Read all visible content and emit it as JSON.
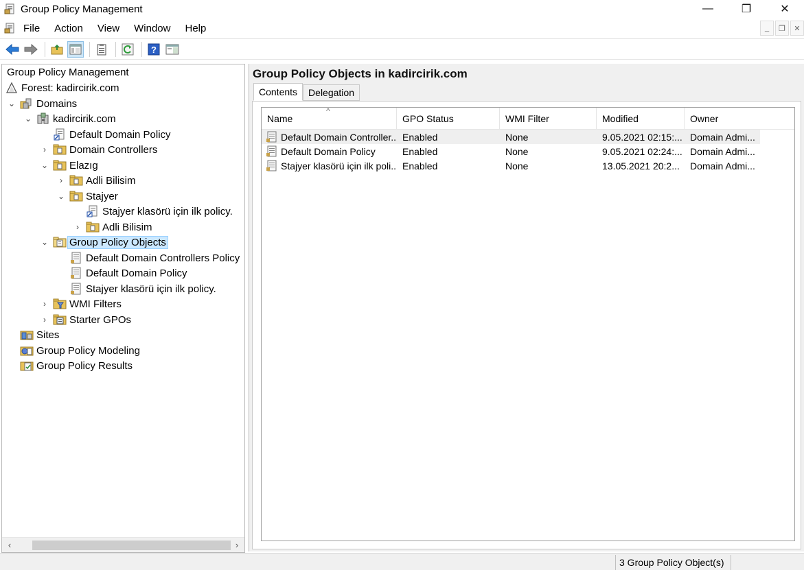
{
  "window": {
    "title": "Group Policy Management",
    "minimize": "—",
    "maximize": "❐",
    "close": "✕"
  },
  "menu": {
    "items": [
      "File",
      "Action",
      "View",
      "Window",
      "Help"
    ]
  },
  "tree": {
    "root": "Group Policy Management",
    "rows": [
      {
        "label": "Forest: kadircirik.com",
        "icon": "forest-icon"
      },
      {
        "label": "Domains",
        "icon": "domains-icon"
      },
      {
        "label": "kadircirik.com",
        "icon": "domain-icon"
      },
      {
        "label": "Default Domain Policy",
        "icon": "gpo-link-icon"
      },
      {
        "label": "Domain Controllers",
        "icon": "ou-icon"
      },
      {
        "label": "Elazıg",
        "icon": "ou-icon"
      },
      {
        "label": "Adli Bilisim",
        "icon": "ou-icon"
      },
      {
        "label": "Stajyer",
        "icon": "ou-icon"
      },
      {
        "label": "Stajyer klasörü için ilk policy.",
        "icon": "gpo-link-icon"
      },
      {
        "label": "Adli Bilisim",
        "icon": "ou-icon"
      },
      {
        "label": "Group Policy Objects",
        "icon": "gpo-folder-icon"
      },
      {
        "label": "Default Domain Controllers Policy",
        "icon": "gpo-icon"
      },
      {
        "label": "Default Domain Policy",
        "icon": "gpo-icon"
      },
      {
        "label": "Stajyer klasörü için ilk policy.",
        "icon": "gpo-icon"
      },
      {
        "label": "WMI Filters",
        "icon": "wmi-folder-icon"
      },
      {
        "label": "Starter GPOs",
        "icon": "starter-folder-icon"
      },
      {
        "label": "Sites",
        "icon": "sites-icon"
      },
      {
        "label": "Group Policy Modeling",
        "icon": "modeling-icon"
      },
      {
        "label": "Group Policy Results",
        "icon": "results-icon"
      }
    ]
  },
  "right": {
    "title": "Group Policy Objects in kadircirik.com",
    "tabs": [
      "Contents",
      "Delegation"
    ],
    "columns": [
      "Name",
      "GPO Status",
      "WMI Filter",
      "Modified",
      "Owner"
    ],
    "rows": [
      [
        "Default Domain Controller...",
        "Enabled",
        "None",
        "9.05.2021 02:15:...",
        "Domain Admi..."
      ],
      [
        "Default Domain Policy",
        "Enabled",
        "None",
        "9.05.2021 02:24:...",
        "Domain Admi..."
      ],
      [
        "Stajyer klasörü için ilk poli...",
        "Enabled",
        "None",
        "13.05.2021 20:2...",
        "Domain Admi..."
      ]
    ]
  },
  "status": {
    "text": "3 Group Policy Object(s)"
  }
}
